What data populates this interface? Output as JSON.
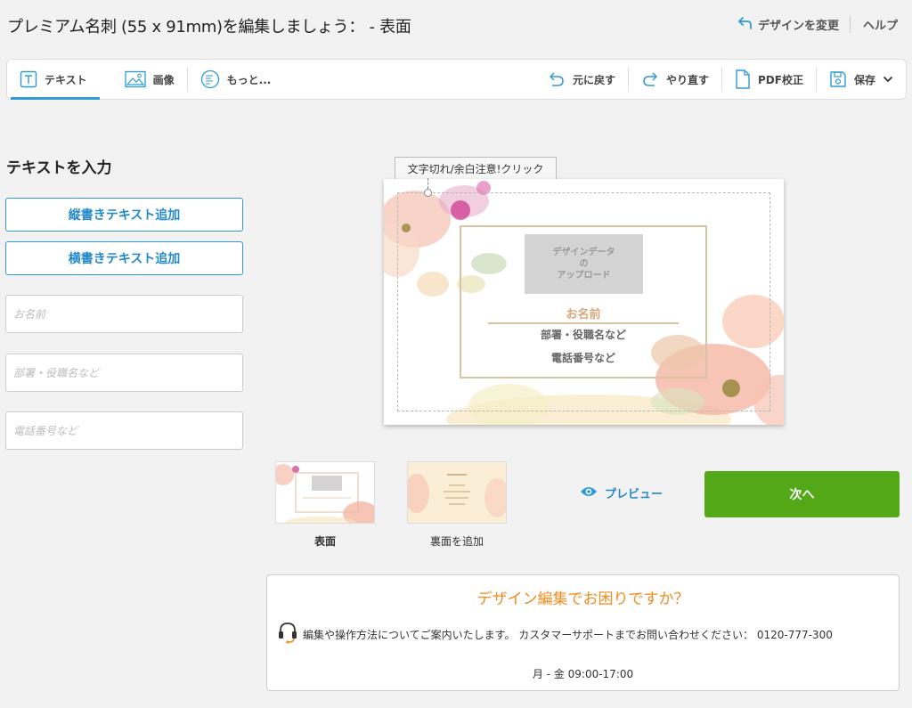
{
  "header": {
    "title": "プレミアム名刺 (55 x 91mm)を編集しましょう： - 表面",
    "change_design": "デザインを変更",
    "help": "ヘルプ"
  },
  "toolbar": {
    "text": "テキスト",
    "image": "画像",
    "more": "もっと...",
    "undo": "元に戻す",
    "redo": "やり直す",
    "pdf": "PDF校正",
    "save": "保存"
  },
  "left_panel": {
    "title": "テキストを入力",
    "add_vertical": "縦書きテキスト追加",
    "add_horizontal": "横書きテキスト追加",
    "fields": [
      {
        "placeholder": "お名前",
        "value": ""
      },
      {
        "placeholder": "部署・役職名など",
        "value": ""
      },
      {
        "placeholder": "電話番号など",
        "value": ""
      }
    ]
  },
  "canvas": {
    "tooltip": "文字切れ/余白注意!クリック",
    "upload_line1": "デザインデータ",
    "upload_line2": "の",
    "upload_line3": "アップロード",
    "name": "お名前",
    "dept": "部署・役職名など",
    "tel": "電話番号など"
  },
  "thumbnails": [
    {
      "label": "表面",
      "selected": true
    },
    {
      "label": "裏面を追加",
      "selected": false
    }
  ],
  "actions": {
    "preview": "プレビュー",
    "next": "次へ"
  },
  "support": {
    "title": "デザイン編集でお困りですか？",
    "text": "編集や操作方法についてご案内いたします。 カスタマーサポートまでお問い合わせください： 0120-777-300",
    "hours": "月 - 金 09:00-17:00"
  },
  "colors": {
    "accent_blue": "#2e9ad8",
    "next_green": "#52a817",
    "support_orange": "#f08c1e",
    "frame_gold": "#d8c3a0"
  },
  "icons": [
    "undo-arrow-icon",
    "text-icon",
    "image-icon",
    "more-icon",
    "undo-icon",
    "redo-icon",
    "pdf-icon",
    "save-icon",
    "chevron-down-icon",
    "eye-icon",
    "headset-icon"
  ]
}
